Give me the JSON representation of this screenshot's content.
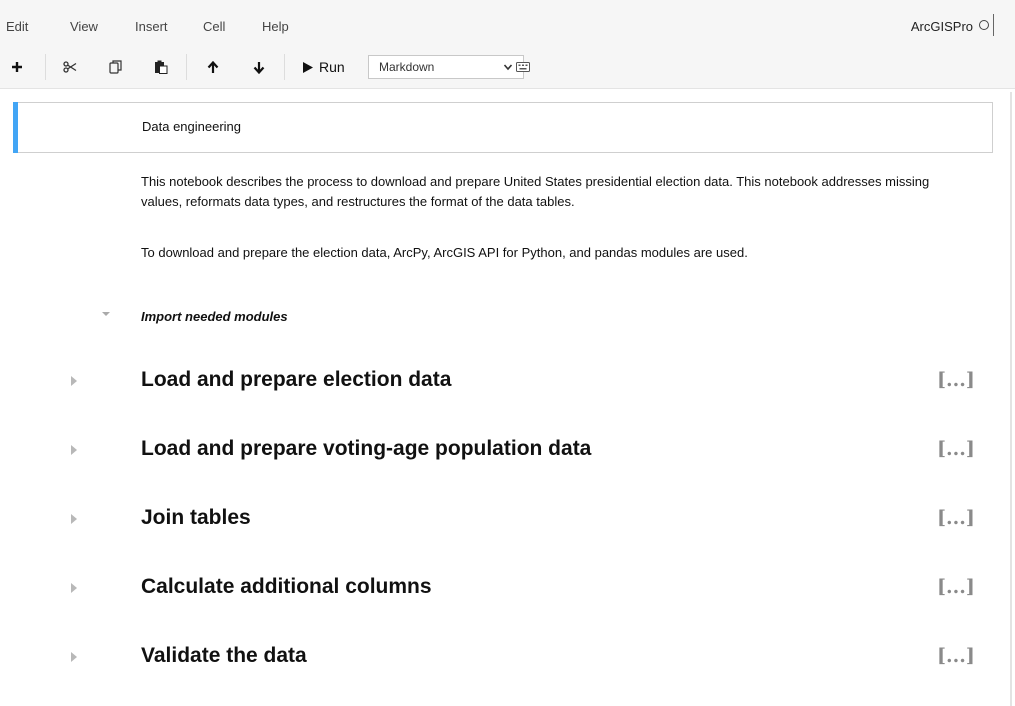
{
  "menu": {
    "items": [
      "Edit",
      "View",
      "Insert",
      "Cell",
      "Help"
    ],
    "kernel_name": "ArcGISPro"
  },
  "toolbar": {
    "run_label": "Run",
    "cell_type": "Markdown",
    "icons": [
      "plus-icon",
      "cut-icon",
      "copy-icon",
      "paste-icon",
      "arrow-up-icon",
      "arrow-down-icon",
      "run-icon",
      "keyboard-icon"
    ]
  },
  "notebook": {
    "selected_cell_text": "Data engineering",
    "intro_paragraph": "This notebook describes the process to download and prepare United States presidential election data. This notebook addresses missing values, reformats data types, and restructures the format of the data tables.",
    "modules_paragraph": "To download and prepare the election data, ArcPy, ArcGIS API for Python, and pandas modules are used.",
    "import_heading": "Import needed modules",
    "sections": [
      {
        "title": "Load and prepare election data",
        "collapsed_marker": "[...]"
      },
      {
        "title": "Load and prepare voting-age population data",
        "collapsed_marker": "[...]"
      },
      {
        "title": "Join tables",
        "collapsed_marker": "[...]"
      },
      {
        "title": "Calculate additional columns",
        "collapsed_marker": "[...]"
      },
      {
        "title": "Validate the data",
        "collapsed_marker": "[...]"
      }
    ]
  },
  "colors": {
    "selected_cell_accent": "#42a5f5",
    "toolbar_bg": "#f6f6f6",
    "ellipsis": "#8a8a8a"
  }
}
